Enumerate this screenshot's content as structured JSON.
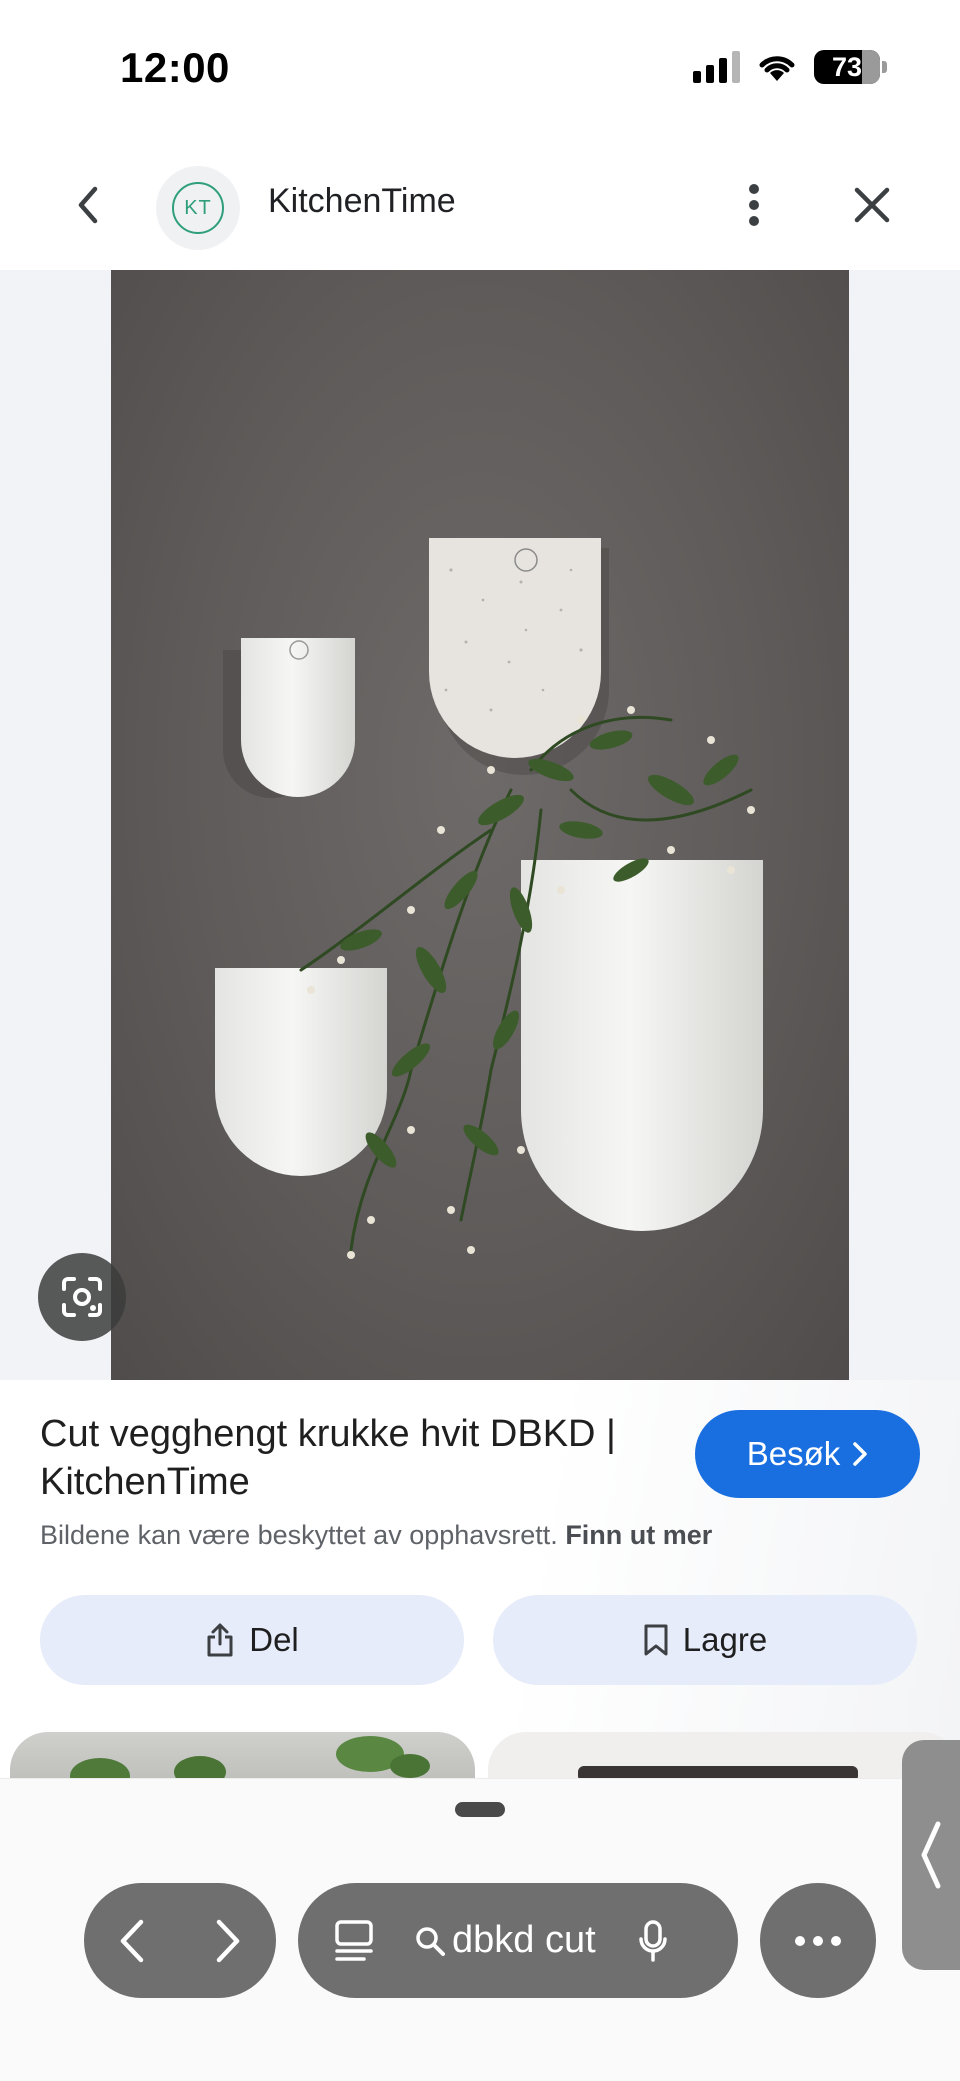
{
  "status_bar": {
    "time": "12:00",
    "battery": "73",
    "battery_level": 0.73
  },
  "header": {
    "site_logo_text": "KT",
    "site_name": "KitchenTime"
  },
  "result": {
    "title": "Cut vegghengt krukke hvit DBKD | KitchenTime",
    "visit_label": "Besøk",
    "copyright_text": "Bildene kan være beskyttet av opphavsrett.",
    "learn_more_label": "Finn ut mer",
    "share_label": "Del",
    "save_label": "Lagre"
  },
  "toolbar": {
    "search_query": "dbkd cut"
  },
  "icons": {
    "back": "chevron-left-icon",
    "more": "more-vert-icon",
    "close": "close-icon",
    "lens": "lens-icon",
    "share": "share-icon",
    "save": "bookmark-icon",
    "tabs": "tabs-icon",
    "search": "search-icon",
    "mic": "mic-icon",
    "menu": "more-horiz-icon",
    "side": "chevron-left-icon"
  },
  "colors": {
    "accent": "#1a6fe0",
    "pill": "#e6ecfa",
    "logo": "#2e9e7c",
    "toolbar": "#6f6f6f"
  }
}
